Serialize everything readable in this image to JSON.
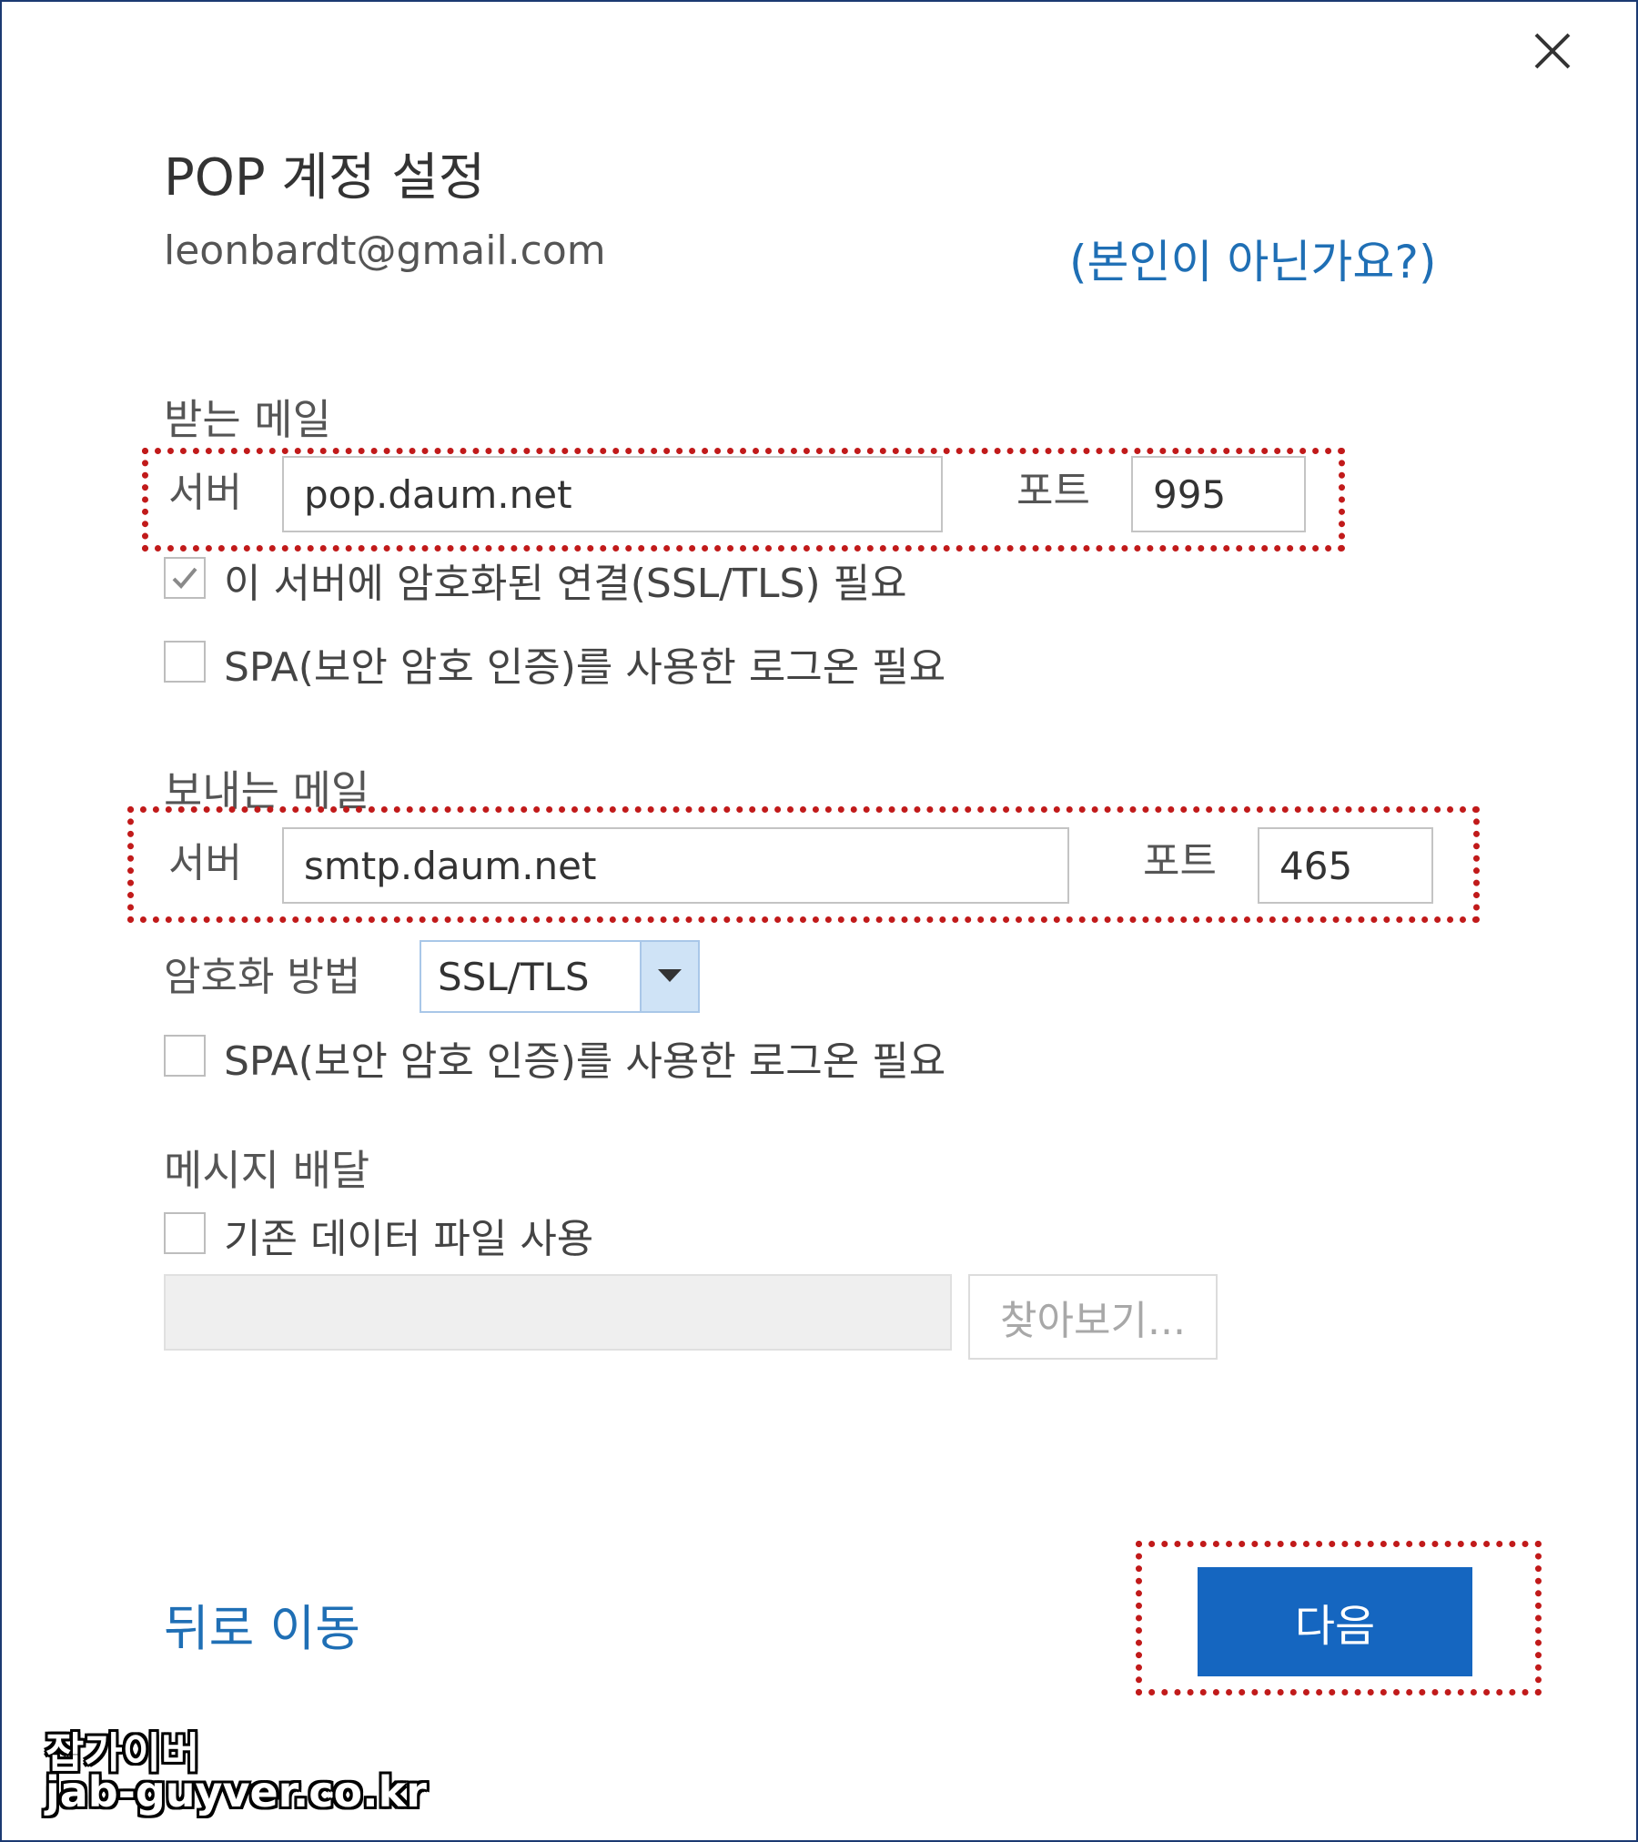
{
  "dialog": {
    "title": "POP 계정 설정",
    "email": "leonbardt@gmail.com",
    "not_you_link": "(본인이 아닌가요?)",
    "close_icon": "close-icon"
  },
  "incoming": {
    "section_label": "받는 메일",
    "server_label": "서버",
    "server_value": "pop.daum.net",
    "port_label": "포트",
    "port_value": "995",
    "ssl_checkbox": {
      "label": "이 서버에 암호화된 연결(SSL/TLS) 필요",
      "checked": true
    },
    "spa_checkbox": {
      "label": "SPA(보안 암호 인증)를 사용한 로그온 필요",
      "checked": false
    }
  },
  "outgoing": {
    "section_label": "보내는 메일",
    "server_label": "서버",
    "server_value": "smtp.daum.net",
    "port_label": "포트",
    "port_value": "465",
    "encryption_label": "암호화 방법",
    "encryption_value": "SSL/TLS",
    "spa_checkbox": {
      "label": "SPA(보안 암호 인증)를 사용한 로그온 필요",
      "checked": false
    }
  },
  "delivery": {
    "section_label": "메시지 배달",
    "existing_file_checkbox": {
      "label": "기존 데이터 파일 사용",
      "checked": false
    },
    "file_path_value": "",
    "browse_label": "찾아보기..."
  },
  "footer": {
    "back_link": "뒤로 이동",
    "next_button": "다음"
  },
  "watermark": {
    "line1": "잡가이버",
    "line2": "jab-guyver.co.kr"
  },
  "colors": {
    "accent_link": "#1f6fb5",
    "primary_button": "#1566c0",
    "highlight_dotted": "#c11a1a"
  }
}
